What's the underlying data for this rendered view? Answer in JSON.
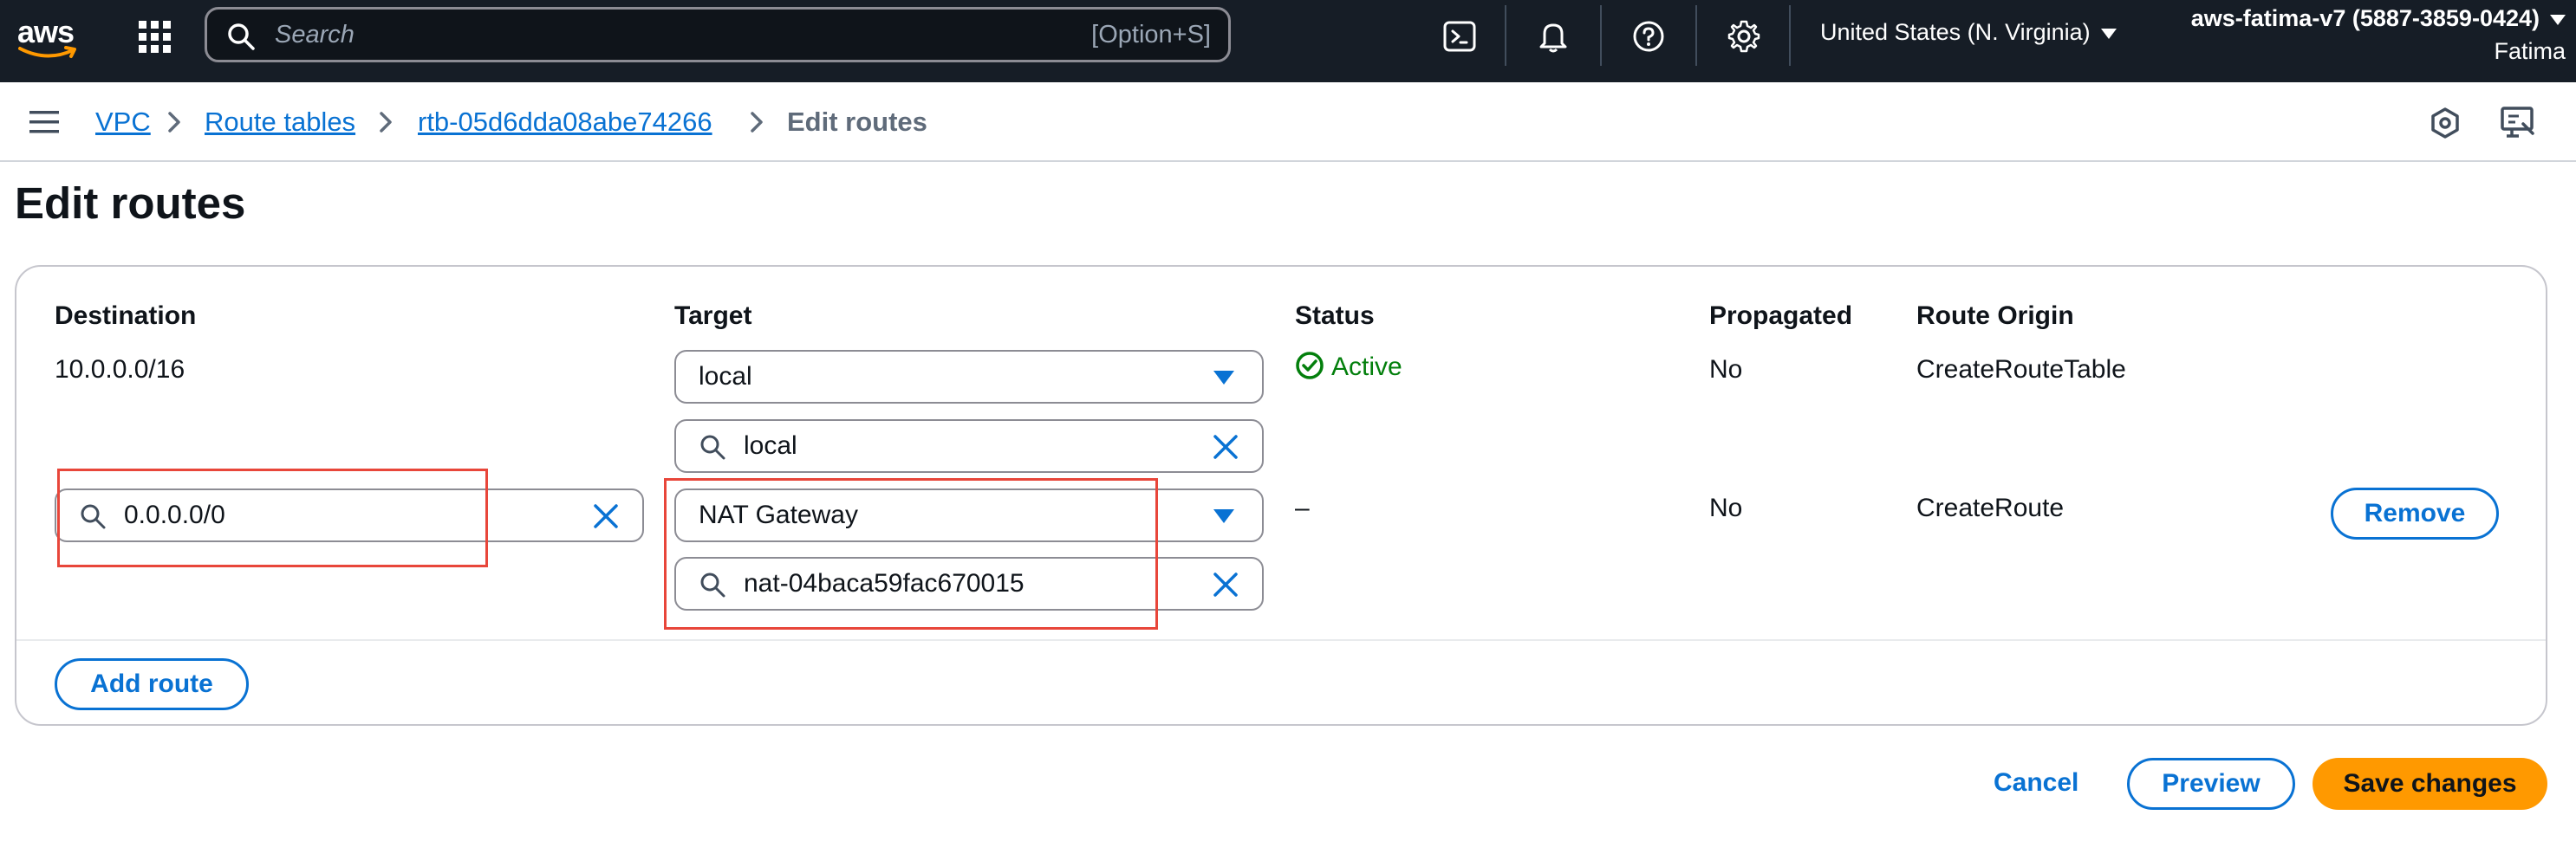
{
  "topbar": {
    "logo": "aws",
    "search_placeholder": "Search",
    "search_shortcut": "[Option+S]",
    "region": "United States (N. Virginia)",
    "account_name": "aws-fatima-v7 (5887-3859-0424)",
    "user": "Fatima",
    "icons": [
      "services-grid-icon",
      "search-icon",
      "cloudshell-icon",
      "bell-icon",
      "help-icon",
      "gear-icon"
    ]
  },
  "breadcrumb": {
    "items": [
      "VPC",
      "Route tables",
      "rtb-05d6dda08abe74266"
    ],
    "current": "Edit routes"
  },
  "page": {
    "title": "Edit routes"
  },
  "table": {
    "columns": [
      "Destination",
      "Target",
      "Status",
      "Propagated",
      "Route Origin"
    ],
    "rows": [
      {
        "destination": "10.0.0.0/16",
        "target_type": "local",
        "target_filter": "local",
        "status": "Active",
        "propagated": "No",
        "route_origin": "CreateRouteTable"
      },
      {
        "destination": "0.0.0.0/0",
        "target_type": "NAT Gateway",
        "target_filter": "nat-04baca59fac670015",
        "status": "–",
        "propagated": "No",
        "route_origin": "CreateRoute",
        "remove_label": "Remove"
      }
    ],
    "add_route_label": "Add route"
  },
  "footer": {
    "cancel_label": "Cancel",
    "preview_label": "Preview",
    "save_label": "Save changes"
  },
  "colors": {
    "topbar_bg": "#161d26",
    "link": "#0972d3",
    "primary_button": "#ff9900",
    "success": "#037f0c",
    "highlight": "#e8463a"
  }
}
